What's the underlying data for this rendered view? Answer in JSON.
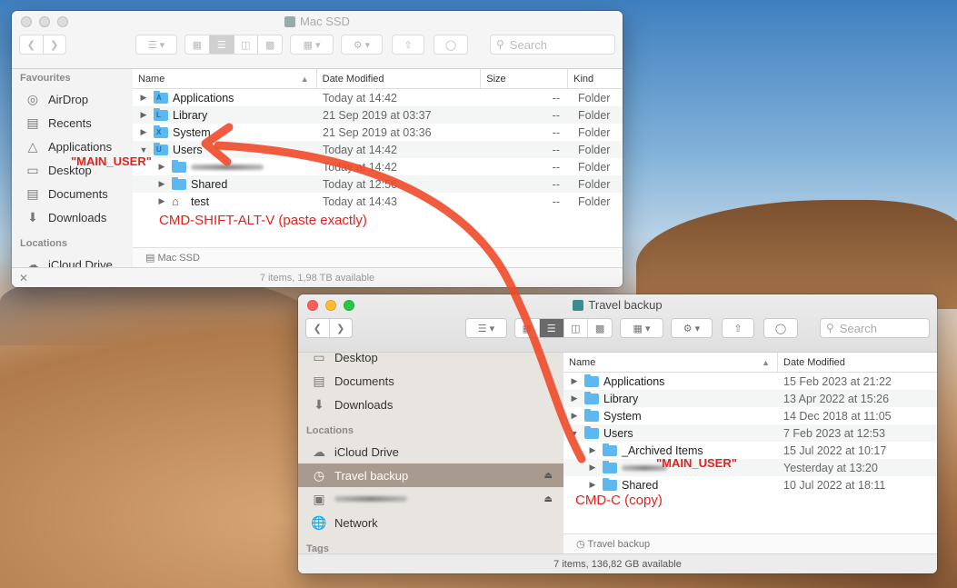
{
  "win1": {
    "title": "Mac SSD",
    "search_placeholder": "Search",
    "sidebar": {
      "favourites_header": "Favourites",
      "items": [
        {
          "label": "AirDrop",
          "icon": "airdrop-icon"
        },
        {
          "label": "Recents",
          "icon": "recents-icon"
        },
        {
          "label": "Applications",
          "icon": "applications-icon"
        },
        {
          "label": "Desktop",
          "icon": "desktop-icon"
        },
        {
          "label": "Documents",
          "icon": "documents-icon"
        },
        {
          "label": "Downloads",
          "icon": "downloads-icon"
        }
      ],
      "locations_header": "Locations",
      "location_items": [
        {
          "label": "iCloud Drive",
          "icon": "cloud-icon"
        }
      ]
    },
    "columns": {
      "name": "Name",
      "date": "Date Modified",
      "size": "Size",
      "kind": "Kind"
    },
    "rows": [
      {
        "name": "Applications",
        "date": "Today at 14:42",
        "size": "--",
        "kind": "Folder",
        "glyph": "A"
      },
      {
        "name": "Library",
        "date": "21 Sep 2019 at 03:37",
        "size": "--",
        "kind": "Folder",
        "glyph": "L"
      },
      {
        "name": "System",
        "date": "21 Sep 2019 at 03:36",
        "size": "--",
        "kind": "Folder",
        "glyph": "X"
      },
      {
        "name": "Users",
        "date": "Today at 14:42",
        "size": "--",
        "kind": "Folder",
        "glyph": "U"
      },
      {
        "name": "",
        "date": "Today at 14:42",
        "size": "--",
        "kind": "Folder",
        "glyph": ""
      },
      {
        "name": "Shared",
        "date": "Today at 12:56",
        "size": "--",
        "kind": "Folder",
        "glyph": ""
      },
      {
        "name": "test",
        "date": "Today at 14:43",
        "size": "--",
        "kind": "Folder",
        "glyph": ""
      }
    ],
    "path": "Mac SSD",
    "status": "7 items, 1,98 TB available"
  },
  "win2": {
    "title": "Travel backup",
    "search_placeholder": "Search",
    "sidebar": {
      "items": [
        {
          "label": "Desktop",
          "icon": "desktop-icon"
        },
        {
          "label": "Documents",
          "icon": "documents-icon"
        },
        {
          "label": "Downloads",
          "icon": "downloads-icon"
        }
      ],
      "locations_header": "Locations",
      "location_items": [
        {
          "label": "iCloud Drive",
          "icon": "cloud-icon"
        },
        {
          "label": "Travel backup",
          "icon": "time-machine-disk-icon"
        },
        {
          "label": "",
          "icon": "disk-icon"
        },
        {
          "label": "Network",
          "icon": "network-icon"
        }
      ],
      "tags_header": "Tags"
    },
    "columns": {
      "name": "Name",
      "date": "Date Modified"
    },
    "rows": [
      {
        "name": "Applications",
        "date": "15 Feb 2023 at 21:22"
      },
      {
        "name": "Library",
        "date": "13 Apr 2022 at 15:26"
      },
      {
        "name": "System",
        "date": "14 Dec 2018 at 11:05"
      },
      {
        "name": "Users",
        "date": "7 Feb 2023 at 12:53"
      },
      {
        "name": "_Archived Items",
        "date": "15 Jul 2022 at 10:17"
      },
      {
        "name": "",
        "date": "Yesterday at 13:20"
      },
      {
        "name": "Shared",
        "date": "10 Jul 2022 at 18:11"
      }
    ],
    "path": "Travel backup",
    "status": "7 items, 136,82 GB available"
  },
  "annotations": {
    "main_user_1": "\"MAIN_USER\"",
    "paste": "CMD-SHIFT-ALT-V (paste exactly)",
    "main_user_2": "\"MAIN_USER\"",
    "copy": "CMD-C (copy)"
  },
  "colors": {
    "annotation": "#e8211b",
    "arrow": "#f04a2a",
    "folder": "#5cb8ef",
    "sidebar_selected": "#a89a8e"
  }
}
